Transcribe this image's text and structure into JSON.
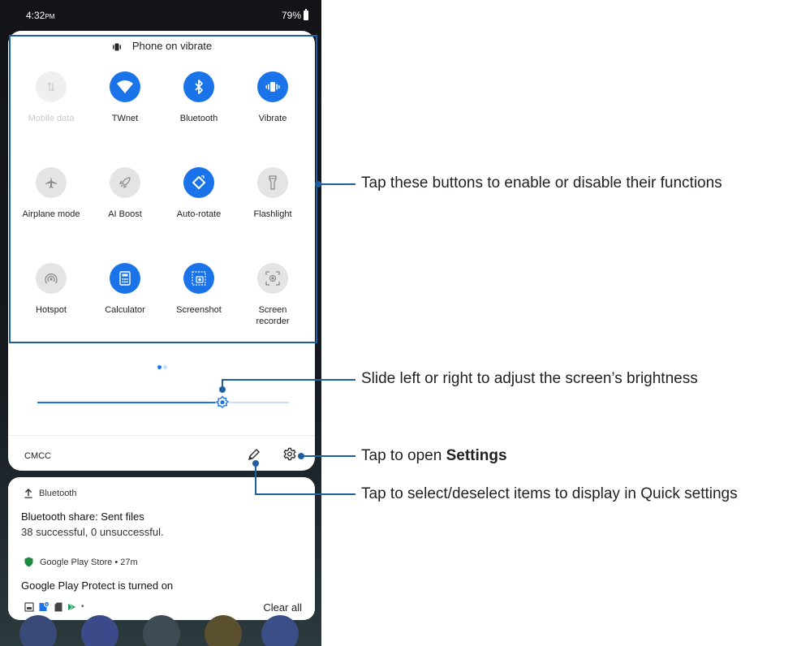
{
  "status_bar": {
    "time": "4:32",
    "ampm": "PM",
    "battery": "79%"
  },
  "quick_settings": {
    "header": "Phone on vibrate",
    "tiles": [
      {
        "label": "Mobile data",
        "state": "off",
        "dim": true,
        "icon": "mobile-data-icon"
      },
      {
        "label": "TWnet",
        "state": "on",
        "icon": "wifi-icon"
      },
      {
        "label": "Bluetooth",
        "state": "on",
        "icon": "bluetooth-icon"
      },
      {
        "label": "Vibrate",
        "state": "on",
        "icon": "vibrate-icon"
      },
      {
        "label": "Airplane mode",
        "state": "off",
        "icon": "airplane-icon"
      },
      {
        "label": "AI Boost",
        "state": "off",
        "icon": "rocket-icon"
      },
      {
        "label": "Auto-rotate",
        "state": "on",
        "icon": "rotate-icon"
      },
      {
        "label": "Flashlight",
        "state": "off",
        "icon": "flashlight-icon"
      },
      {
        "label": "Hotspot",
        "state": "off",
        "icon": "hotspot-icon"
      },
      {
        "label": "Calculator",
        "state": "on",
        "icon": "calculator-icon"
      },
      {
        "label": "Screenshot",
        "state": "on",
        "icon": "screenshot-icon"
      },
      {
        "label": "Screen\nrecorder",
        "state": "off",
        "icon": "screen-recorder-icon"
      }
    ],
    "page_indicator": {
      "pages": 2,
      "current": 1
    },
    "brightness": {
      "level": 0.74
    },
    "carrier": "CMCC"
  },
  "notifications": {
    "items": [
      {
        "app": "Bluetooth",
        "title": "Bluetooth share: Sent files",
        "body": "38 successful, 0 unsuccessful."
      },
      {
        "app": "Google Play Store • 27m",
        "title": "Google Play Protect is turned on"
      }
    ],
    "clear_all": "Clear all",
    "overflow_dot": "•"
  },
  "annotations": {
    "tiles": "Tap these buttons to enable or disable their functions",
    "brightness": "Slide left or right to adjust the screen’s brightness",
    "settings_prefix": "Tap to open ",
    "settings_bold": "Settings",
    "edit": "Tap to select/deselect items to display in Quick settings"
  },
  "colors": {
    "accent": "#1a73e8",
    "annotation": "#1d5fa0",
    "tile_off": "#e4e4e4"
  }
}
